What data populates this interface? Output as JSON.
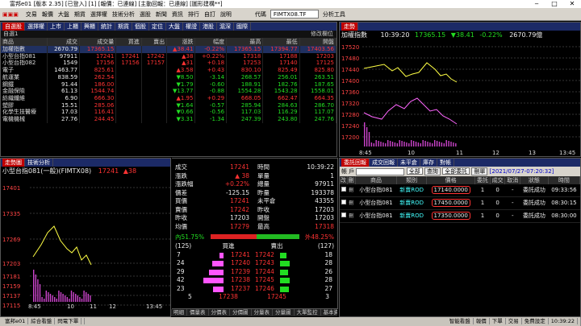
{
  "app": {
    "title": "富邦e01 [版本 2.35] [已登入] [1] [報價：已連線] [主動回報：已連線] [圖形建構**]"
  },
  "toolbar": {
    "items": [
      "交易",
      "報價",
      "大盤",
      "期貨",
      "選擇權",
      "技術分析",
      "選股",
      "新聞",
      "資訊",
      "排行",
      "自訂",
      "說明"
    ],
    "symbol_label": "代碼",
    "symbol_value": "FIMTX08.TF",
    "analysis_label": "分析工具"
  },
  "quote_panel": {
    "tabs": [
      "自選股",
      "選擇權",
      "上市",
      "上櫃",
      "興櫃",
      "統計",
      "期貨",
      "個股",
      "定位",
      "大盤",
      "權證",
      "港股",
      "滬深",
      "國際"
    ],
    "group_label": "自選1",
    "edit_label": "修改欄位",
    "columns": [
      "商品",
      "成交",
      "成交量",
      "買進",
      "賣出",
      "漲跌",
      "幅度",
      "最高",
      "最低",
      "開盤"
    ],
    "rows": [
      {
        "name": "加權指數",
        "price": "2670.79",
        "vol": "17365.15",
        "bid": "",
        "ask": "",
        "chg": "▲38.41",
        "pct": "-0.22%",
        "high": "17365.15",
        "low": "17394.77",
        "open": "17403.56",
        "cls": "up"
      },
      {
        "name": "小型台指081",
        "price": "97911",
        "vol": "17241",
        "bid": "17241",
        "ask": "17242",
        "chg": "▲38",
        "pct": "+0.22%",
        "high": "17318",
        "low": "17188",
        "open": "17203",
        "cls": "up"
      },
      {
        "name": "小型台指082",
        "price": "1549",
        "vol": "17156",
        "bid": "17156",
        "ask": "17157",
        "chg": "▲31",
        "pct": "+0.18",
        "high": "17253",
        "low": "17140",
        "open": "17125",
        "cls": "up"
      },
      {
        "name": "電子",
        "price": "1463.77",
        "vol": "825.61",
        "bid": "",
        "ask": "",
        "chg": "▲3.58",
        "pct": "+0.43",
        "high": "830.10",
        "low": "825.49",
        "open": "825.80",
        "cls": "up"
      },
      {
        "name": "航運業",
        "price": "838.59",
        "vol": "262.54",
        "bid": "",
        "ask": "",
        "chg": "▼8.50",
        "pct": "-3.14",
        "high": "268.57",
        "low": "256.01",
        "open": "263.51",
        "cls": "dn"
      },
      {
        "name": "鋼鐵",
        "price": "91.44",
        "vol": "186.00",
        "bid": "",
        "ask": "",
        "chg": "▼1.79",
        "pct": "-0.60",
        "high": "188.91",
        "low": "182.76",
        "open": "187.65",
        "cls": "dn"
      },
      {
        "name": "金融保險",
        "price": "61.13",
        "vol": "1544.74",
        "bid": "",
        "ask": "",
        "chg": "▼13.77",
        "pct": "-0.88",
        "high": "1554.28",
        "low": "1543.28",
        "open": "1558.01",
        "cls": "dn"
      },
      {
        "name": "紡織纖維",
        "price": "6.90",
        "vol": "666.30",
        "bid": "",
        "ask": "",
        "chg": "▲1.95",
        "pct": "+0.29",
        "high": "668.05",
        "low": "662.47",
        "open": "664.35",
        "cls": "up"
      },
      {
        "name": "塑膠",
        "price": "15.51",
        "vol": "285.06",
        "bid": "",
        "ask": "",
        "chg": "▼1.64",
        "pct": "-0.57",
        "high": "285.94",
        "low": "284.63",
        "open": "286.70",
        "cls": "dn"
      },
      {
        "name": "化學生技醫療",
        "price": "17.03",
        "vol": "116.41",
        "bid": "",
        "ask": "",
        "chg": "▼0.66",
        "pct": "-0.56",
        "high": "117.03",
        "low": "116.29",
        "open": "117.07",
        "cls": "dn"
      },
      {
        "name": "電機機械",
        "price": "27.76",
        "vol": "244.45",
        "bid": "",
        "ask": "",
        "chg": "▼3.31",
        "pct": "-1.34",
        "high": "247.39",
        "low": "243.80",
        "open": "247.76",
        "cls": "dn"
      }
    ]
  },
  "index_chart": {
    "title": "加權指數",
    "time": "10:39:20",
    "price": "17365.15",
    "change": "▼38.41",
    "pct": "-0.22%",
    "volume": "2670.79億",
    "y_ticks": [
      "17520",
      "17480",
      "17440",
      "17400",
      "17360",
      "17320",
      "17280",
      "17240",
      "17200"
    ],
    "x_ticks": [
      "8:45",
      "10",
      "11",
      "12",
      "13",
      "13:45"
    ]
  },
  "futures_chart": {
    "tabs": [
      "走勢圖",
      "技術分析"
    ],
    "title": "小型台指081(一般)(FIMTX08)",
    "price": "17241",
    "change": "▲38",
    "y_ticks": [
      "17401",
      "17335",
      "17269",
      "17203",
      "17181",
      "17159",
      "17137",
      "17115"
    ],
    "x_ticks": [
      "8:45",
      "10",
      "11",
      "12",
      "13:45"
    ],
    "bottom_tabs": [
      "明細",
      "價量表",
      "分價表",
      "分價圖",
      "分量表",
      "分量圖",
      "大單監控",
      "基本資料"
    ]
  },
  "detail": {
    "left": [
      {
        "label": "成交",
        "value": "17241",
        "cls": "up"
      },
      {
        "label": "漲跌",
        "value": "▲ 38",
        "cls": "up"
      },
      {
        "label": "漲跌幅",
        "value": "+0.22%",
        "cls": "up"
      },
      {
        "label": "價差",
        "value": "-125.15",
        "cls": "wt"
      },
      {
        "label": "買價",
        "value": "17241",
        "cls": "up"
      },
      {
        "label": "賣價",
        "value": "17242",
        "cls": "up"
      },
      {
        "label": "昨收",
        "value": "17203",
        "cls": "wt"
      },
      {
        "label": "均價",
        "value": "17279",
        "cls": "up"
      }
    ],
    "right": [
      {
        "label": "時間",
        "value": "10:39:22",
        "cls": "wt"
      },
      {
        "label": "單量",
        "value": "1",
        "cls": "wt"
      },
      {
        "label": "總量",
        "value": "97911",
        "cls": "wt"
      },
      {
        "label": "昨量",
        "value": "193378",
        "cls": "wt"
      },
      {
        "label": "未平倉",
        "value": "43355",
        "cls": "wt"
      },
      {
        "label": "昨收",
        "value": "17203",
        "cls": "wt"
      },
      {
        "label": "開盤",
        "value": "17203",
        "cls": "wt"
      },
      {
        "label": "最高",
        "value": "17318",
        "cls": "up"
      }
    ],
    "bar_left": "內51.75%",
    "bar_right": "外48.25%",
    "bar_fraction": 0.5175,
    "book_header": {
      "left": "(125)",
      "bid": "買進",
      "ask": "賣出",
      "right": "(127)"
    },
    "book": [
      {
        "bq": "7",
        "bp": "17241",
        "ap": "17242",
        "aq": "18",
        "bw": 0.2,
        "aw": 0.3
      },
      {
        "bq": "24",
        "bp": "17240",
        "ap": "17243",
        "aq": "28",
        "bw": 0.55,
        "aw": 0.45
      },
      {
        "bq": "29",
        "bp": "17239",
        "ap": "17244",
        "aq": "26",
        "bw": 0.7,
        "aw": 0.4
      },
      {
        "bq": "42",
        "bp": "17238",
        "ap": "17245",
        "aq": "28",
        "bw": 0.95,
        "aw": 0.45
      },
      {
        "bq": "23",
        "bp": "17237",
        "ap": "17246",
        "aq": "27",
        "bw": 0.5,
        "aw": 0.42
      }
    ],
    "book_footer": {
      "left": "5",
      "bid": "17238",
      "ask": "17245",
      "right": "3"
    }
  },
  "orders": {
    "title": "委託回報",
    "tabs": [
      "委託回報",
      "成交回報",
      "未平倉",
      "庫存",
      "對帳"
    ],
    "account_label": "帳 戶",
    "filter1": "全部",
    "query_label": "查詢",
    "filter2": "全部委託",
    "cancel_label": "刪單",
    "timestamp": "[2021/07/27-07:20:32]",
    "columns": [
      "改",
      "刪",
      "商品",
      "類別",
      "價格",
      "委託",
      "成交",
      "取消",
      "狀態",
      "時間"
    ],
    "rows": [
      {
        "product": "小型台指081",
        "type": "新賣ROD",
        "price": "17140.0000",
        "ord": "1",
        "fill": "0",
        "cxl": "-",
        "status": "委託成功",
        "time": "09:33:56"
      },
      {
        "product": "小型台指081",
        "type": "新賣ROD",
        "price": "17450.0000",
        "ord": "1",
        "fill": "0",
        "cxl": "-",
        "status": "委託成功",
        "time": "08:30:15"
      },
      {
        "product": "小型台指081",
        "type": "新賣ROD",
        "price": "17350.0000",
        "ord": "1",
        "fill": "0",
        "cxl": "-",
        "status": "委託成功",
        "time": "08:30:00"
      }
    ]
  },
  "statusbar": {
    "items": [
      "富邦e01",
      "綜合看盤",
      "閃電下單"
    ],
    "right_items": [
      "智能看盤",
      "報價",
      "下單",
      "交易",
      "免費設定",
      "10:39:22"
    ]
  }
}
